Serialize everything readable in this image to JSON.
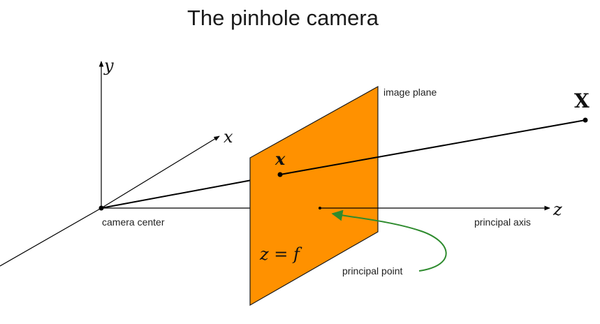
{
  "title": "The pinhole camera",
  "axes": {
    "y_label": "y",
    "x_label": "x",
    "z_label": "z"
  },
  "labels": {
    "image_plane": "image plane",
    "camera_center": "camera center",
    "principal_axis": "principal axis",
    "principal_point": "principal point",
    "world_point": "X",
    "image_point": "x",
    "plane_equation": "z = f"
  },
  "colors": {
    "image_plane_fill": "#FF9100",
    "principal_point_arrow": "#2E8B2E",
    "lines": "#000000"
  }
}
